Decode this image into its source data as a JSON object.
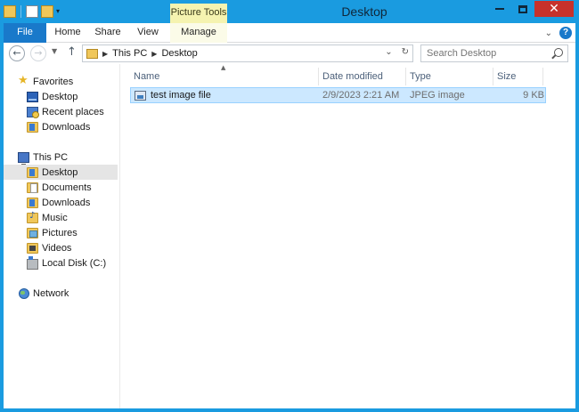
{
  "window": {
    "title": "Desktop",
    "context_group": "Picture Tools",
    "accent": "#1a9be0",
    "close_glyph": "✕"
  },
  "ribbon": {
    "tabs": [
      {
        "label": "File"
      },
      {
        "label": "Home"
      },
      {
        "label": "Share"
      },
      {
        "label": "View"
      },
      {
        "label": "Manage"
      }
    ],
    "help_glyph": "?"
  },
  "address": {
    "crumbs": [
      "This PC",
      "Desktop"
    ],
    "search_placeholder": "Search Desktop"
  },
  "nav": {
    "favorites_label": "Favorites",
    "favorites": [
      {
        "label": "Desktop",
        "icon": "desktop-icon"
      },
      {
        "label": "Recent places",
        "icon": "recent-places-icon"
      },
      {
        "label": "Downloads",
        "icon": "downloads-folder-icon"
      }
    ],
    "thispc_label": "This PC",
    "thispc": [
      {
        "label": "Desktop",
        "icon": "desktop-folder-icon",
        "selected": true
      },
      {
        "label": "Documents",
        "icon": "documents-folder-icon"
      },
      {
        "label": "Downloads",
        "icon": "downloads-folder-icon"
      },
      {
        "label": "Music",
        "icon": "music-folder-icon"
      },
      {
        "label": "Pictures",
        "icon": "pictures-folder-icon"
      },
      {
        "label": "Videos",
        "icon": "videos-folder-icon"
      },
      {
        "label": "Local Disk (C:)",
        "icon": "local-disk-icon"
      }
    ],
    "network_label": "Network"
  },
  "columns": {
    "name": "Name",
    "date": "Date modified",
    "type": "Type",
    "size": "Size"
  },
  "files": [
    {
      "name": "test image file",
      "date": "2/9/2023 2:21 AM",
      "type": "JPEG image",
      "size": "9 KB",
      "selected": true
    }
  ]
}
